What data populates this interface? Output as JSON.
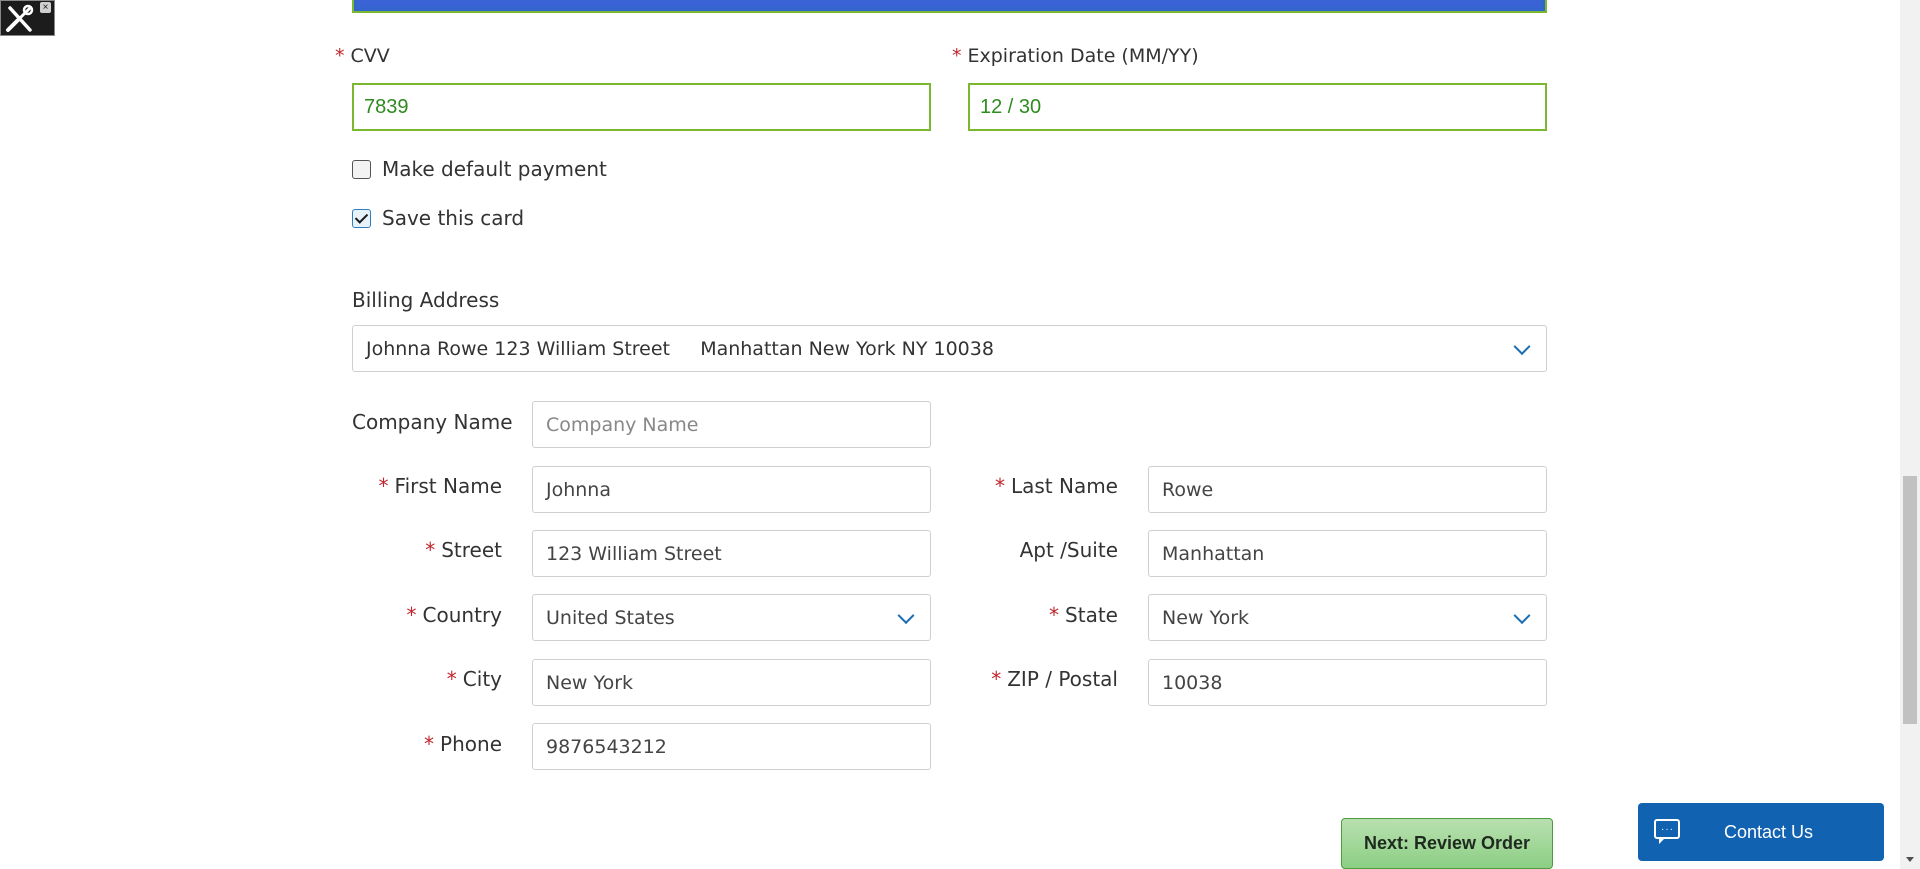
{
  "devtools": {
    "close_label": "×"
  },
  "payment": {
    "cvv_label": "CVV",
    "cvv_value": "7839",
    "expiration_label": "Expiration Date (MM/YY)",
    "expiration_value": "12 / 30",
    "required_mark": "*",
    "make_default_label": "Make default payment",
    "make_default_checked": false,
    "save_card_label": "Save this card",
    "save_card_checked": true
  },
  "billing": {
    "heading": "Billing Address",
    "selected_address": "Johnna Rowe 123 William Street     Manhattan New York NY 10038"
  },
  "address_form": {
    "company_label": "Company Name",
    "company_placeholder": "Company Name",
    "first_name_label": "First Name",
    "first_name_value": "Johnna",
    "last_name_label": "Last Name",
    "last_name_value": "Rowe",
    "street_label": "Street",
    "street_value": "123 William Street",
    "apt_label": "Apt /Suite",
    "apt_value": "Manhattan",
    "country_label": "Country",
    "country_value": "United States",
    "state_label": "State",
    "state_value": "New York",
    "city_label": "City",
    "city_value": "New York",
    "zip_label": "ZIP / Postal",
    "zip_value": "10038",
    "phone_label": "Phone",
    "phone_value": "9876543212"
  },
  "actions": {
    "next_label": "Next: Review Order"
  },
  "contact": {
    "label": "Contact Us"
  }
}
